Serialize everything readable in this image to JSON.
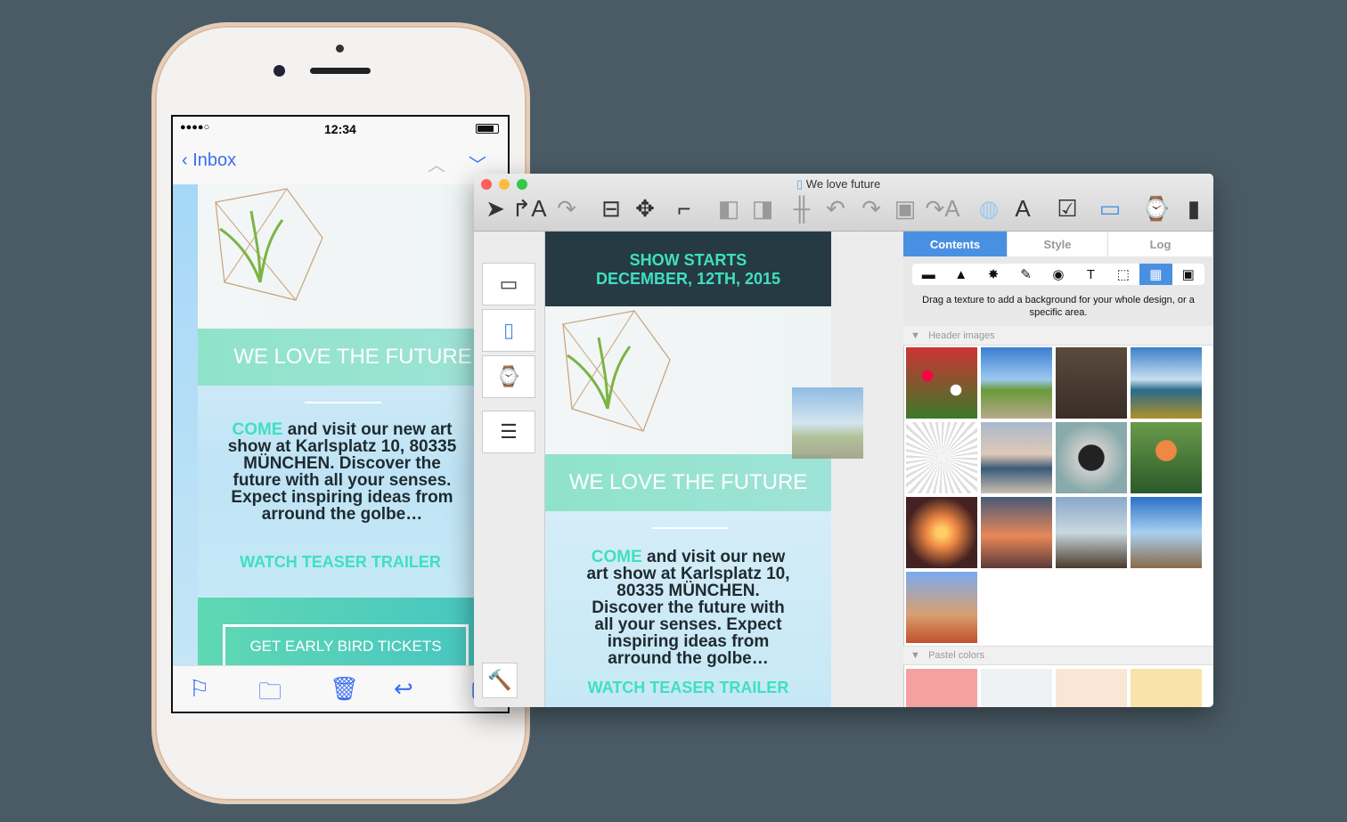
{
  "phone": {
    "signal": "●●●●○",
    "time": "12:34",
    "back_label": "Inbox",
    "email": {
      "headline": "WE LOVE THE FUTURE",
      "come": "COME",
      "body": " and visit our new art show at Karlsplatz 10, 80335 MÜNCHEN. Discover the future with all your senses. Expect inspiring ideas from arround the golbe…",
      "cta": "WATCH TEASER TRAILER",
      "tickets": "GET EARLY BIRD TICKETS"
    },
    "tabbar": [
      "flag-icon",
      "folder-icon",
      "trash-icon",
      "reply-icon",
      "compose-icon"
    ]
  },
  "window": {
    "title": "We love future",
    "toolbar": [
      "send-icon",
      "export-text-icon",
      "share-icon",
      "layout-icon",
      "move-icon",
      "ruler-icon",
      "send-backward-icon",
      "bring-forward-icon",
      "align-icon",
      "undo-icon",
      "redo-icon",
      "group-icon",
      "text-redo-icon",
      "colors-icon",
      "fonts-icon",
      "checklist-icon",
      "preview-icon",
      "watch-add-icon",
      "phone-add-icon"
    ],
    "devices": [
      "laptop-icon",
      "phone-icon",
      "watch-icon",
      "newsletter-icon"
    ],
    "canvas": {
      "show_line1": "SHOW STARTS",
      "show_line2": "DECEMBER, 12TH, 2015",
      "headline": "WE LOVE THE FUTURE",
      "come": "COME",
      "body": " and visit our new art show at Karlsplatz 10, 80335 MÜNCHEN. Discover the future with all your senses. Expect inspiring ideas from arround the golbe…",
      "cta": "WATCH TEASER TRAILER"
    },
    "tabs": [
      {
        "label": "Contents",
        "active": true
      },
      {
        "label": "Style"
      },
      {
        "label": "Log"
      }
    ],
    "content_types": [
      {
        "icon": "header-icon",
        "glyph": "▬"
      },
      {
        "icon": "shape-icon",
        "glyph": "▲"
      },
      {
        "icon": "badge-icon",
        "glyph": "✸"
      },
      {
        "icon": "brush-icon",
        "glyph": "✎"
      },
      {
        "icon": "video-icon",
        "glyph": "◉"
      },
      {
        "icon": "text-icon",
        "glyph": "T"
      },
      {
        "icon": "selection-icon",
        "glyph": "⬚"
      },
      {
        "icon": "texture-icon",
        "glyph": "▦",
        "active": true
      },
      {
        "icon": "image-icon",
        "glyph": "▣"
      }
    ],
    "hint": "Drag a texture to add a background for your whole design, or a specific area.",
    "sections": {
      "header_images": "Header images",
      "pastel_colors": "Pastel colors"
    },
    "accent": "#4a90e2",
    "teal": "#3fe0bf"
  }
}
